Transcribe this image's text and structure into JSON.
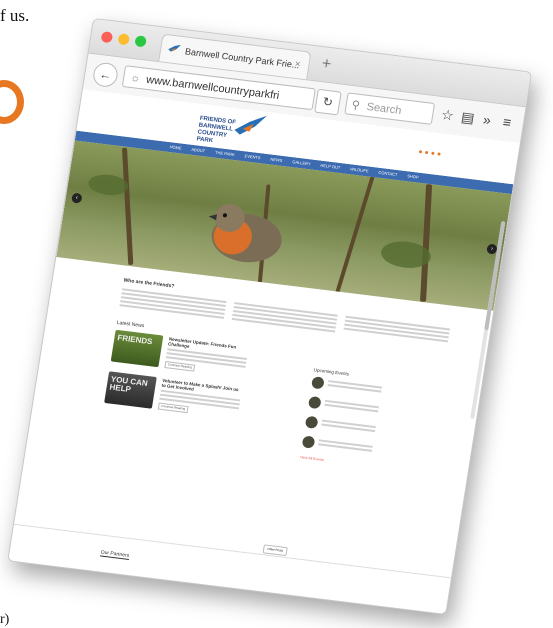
{
  "page_fragments": {
    "top_text": "f us.",
    "bottom_text": "r)"
  },
  "browser": {
    "tab_title": "Barnwell Country Park Frie...",
    "tab_close": "×",
    "new_tab": "+",
    "url": "www.barnwellcountryparkfri",
    "search_placeholder": "Search",
    "icons": [
      "back-arrow-icon",
      "globe-icon",
      "reload-icon",
      "search-icon",
      "bookmark-star-icon",
      "reader-icon",
      "overflow-chevrons-icon",
      "hamburger-menu-icon"
    ]
  },
  "site": {
    "logo_text": "FRIENDS OF BARNWELL COUNTRY PARK",
    "nav_items": [
      "HOME",
      "ABOUT",
      "THE PARK",
      "EVENTS",
      "NEWS",
      "GALLERY",
      "HELP OUT",
      "WILDLIFE",
      "CONTACT",
      "SHOP"
    ],
    "who_title": "Who are the Friends?",
    "latest_news_title": "Latest News",
    "news": [
      {
        "image_text": "FRIENDS",
        "headline": "Newsletter Update: Friends Fun Challenge"
      },
      {
        "image_text": "YOU CAN HELP",
        "headline": "Volunteer to Make a Splash! Join us to Get Involved"
      }
    ],
    "read_more": "Continue Reading",
    "older_posts": "Older Posts",
    "upcoming_events_title": "Upcoming Events",
    "events_count": 4,
    "all_events": "View All Events",
    "partners_title": "Our Partners"
  },
  "colors": {
    "nav_blue": "#3c6bb0",
    "accent_orange": "#e87722"
  }
}
